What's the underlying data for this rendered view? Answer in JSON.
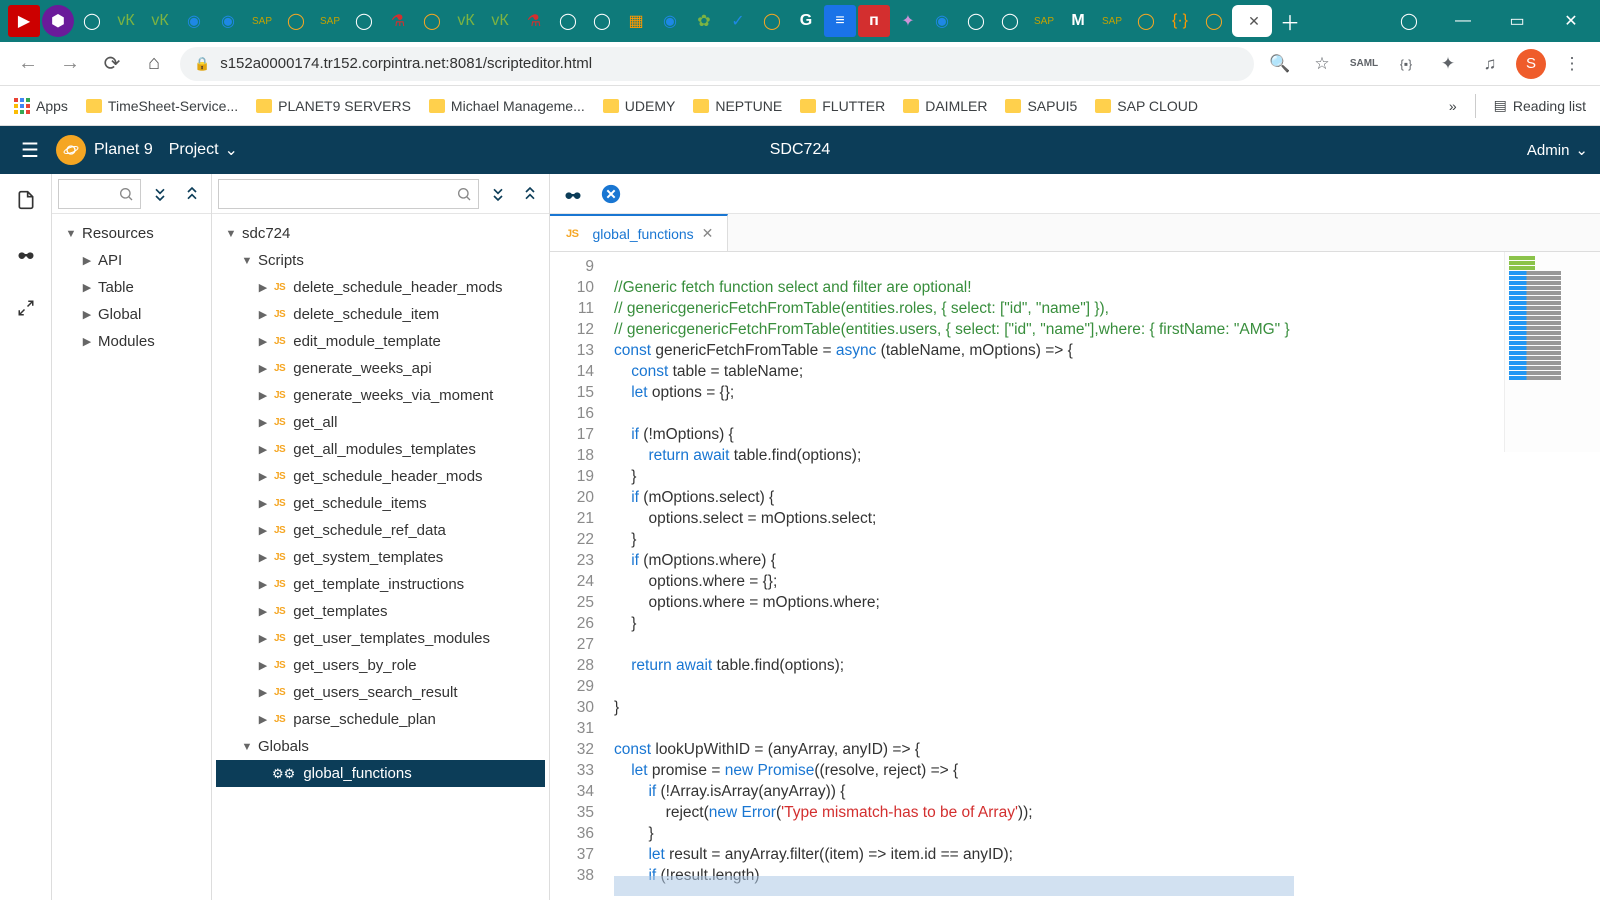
{
  "browser": {
    "url": "s152a0000174.tr152.corpintra.net:8081/scripteditor.html",
    "user_initial": "S",
    "bookmarks_overflow": "»",
    "reading_list": "Reading list",
    "apps_label": "Apps",
    "bookmarks": [
      "TimeSheet-Service...",
      "PLANET9 SERVERS",
      "Michael Manageme...",
      "UDEMY",
      "NEPTUNE",
      "FLUTTER",
      "DAIMLER",
      "SAPUI5",
      "SAP CLOUD"
    ]
  },
  "app": {
    "name": "Planet 9",
    "project_label": "Project",
    "title": "SDC724",
    "admin_label": "Admin"
  },
  "tree_a": {
    "root": "Resources",
    "children": [
      "API",
      "Table",
      "Global",
      "Modules"
    ]
  },
  "tree_b": {
    "root": "sdc724",
    "scripts_label": "Scripts",
    "globals_label": "Globals",
    "scripts": [
      "delete_schedule_header_mods",
      "delete_schedule_item",
      "edit_module_template",
      "generate_weeks_api",
      "generate_weeks_via_moment",
      "get_all",
      "get_all_modules_templates",
      "get_schedule_header_mods",
      "get_schedule_items",
      "get_schedule_ref_data",
      "get_system_templates",
      "get_template_instructions",
      "get_templates",
      "get_user_templates_modules",
      "get_users_by_role",
      "get_users_search_result",
      "parse_schedule_plan"
    ],
    "globals": [
      "global_functions"
    ]
  },
  "editor": {
    "open_tab": "global_functions",
    "first_line_number": 9,
    "code_lines": [
      {
        "n": 9,
        "t": "",
        "cls": ""
      },
      {
        "n": 10,
        "t": "//Generic fetch function select and filter are optional!",
        "cls": "cm"
      },
      {
        "n": 11,
        "t": "// genericgenericFetchFromTable(entities.roles, { select: [\"id\", \"name\"] }),",
        "cls": "cm"
      },
      {
        "n": 12,
        "t": "// genericgenericFetchFromTable(entities.users, { select: [\"id\", \"name\"],where: { firstName: \"AMG\" }",
        "cls": "cm"
      },
      {
        "n": 13,
        "html": "<span class='kw'>const</span> genericFetchFromTable = <span class='kw'>async</span> (tableName, mOptions) =&gt; {"
      },
      {
        "n": 14,
        "html": "    <span class='kw'>const</span> table = tableName;"
      },
      {
        "n": 15,
        "html": "    <span class='kw'>let</span> options = {};"
      },
      {
        "n": 16,
        "t": "",
        "cls": ""
      },
      {
        "n": 17,
        "html": "    <span class='kw'>if</span> (!mOptions) {"
      },
      {
        "n": 18,
        "html": "        <span class='kw'>return await</span> table.find(options);"
      },
      {
        "n": 19,
        "t": "    }",
        "cls": ""
      },
      {
        "n": 20,
        "html": "    <span class='kw'>if</span> (mOptions.select) {"
      },
      {
        "n": 21,
        "t": "        options.select = mOptions.select;",
        "cls": ""
      },
      {
        "n": 22,
        "t": "    }",
        "cls": ""
      },
      {
        "n": 23,
        "html": "    <span class='kw'>if</span> (mOptions.where) {"
      },
      {
        "n": 24,
        "t": "        options.where = {};",
        "cls": ""
      },
      {
        "n": 25,
        "t": "        options.where = mOptions.where;",
        "cls": ""
      },
      {
        "n": 26,
        "t": "    }",
        "cls": ""
      },
      {
        "n": 27,
        "t": "",
        "cls": ""
      },
      {
        "n": 28,
        "html": "    <span class='kw'>return await</span> table.find(options);"
      },
      {
        "n": 29,
        "t": "",
        "cls": ""
      },
      {
        "n": 30,
        "t": "}",
        "cls": ""
      },
      {
        "n": 31,
        "t": "",
        "cls": ""
      },
      {
        "n": 32,
        "html": "<span class='kw'>const</span> lookUpWithID = (anyArray, anyID) =&gt; {"
      },
      {
        "n": 33,
        "html": "    <span class='kw'>let</span> promise = <span class='kw'>new</span> <span class='kw'>Promise</span>((resolve, reject) =&gt; {"
      },
      {
        "n": 34,
        "html": "        <span class='kw'>if</span> (!Array.isArray(anyArray)) {"
      },
      {
        "n": 35,
        "html": "            reject(<span class='kw'>new</span> <span class='kw'>Error</span>(<span class='str'>'Type mismatch-has to be of Array'</span>));"
      },
      {
        "n": 36,
        "t": "        }",
        "cls": ""
      },
      {
        "n": 37,
        "html": "        <span class='kw'>let</span> result = anyArray.filter((item) =&gt; item.id == anyID);"
      },
      {
        "n": 38,
        "html": "        <span class='kw'>if</span> (!result.length)"
      }
    ]
  }
}
